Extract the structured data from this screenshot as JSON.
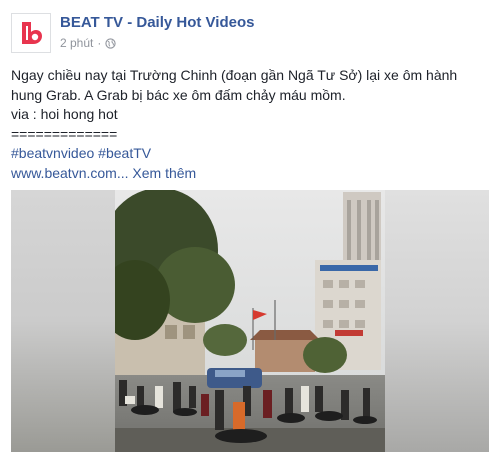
{
  "post": {
    "page_name": "BEAT TV - Daily Hot Videos",
    "timestamp": "2 phút",
    "separator": "·",
    "privacy_icon": "globe-icon",
    "avatar_icon": "beat-logo-icon",
    "text_lines": [
      "Ngay chiều nay tại Trường Chinh (đoạn gần Ngã Tư Sở) lại xe ôm hành",
      "hung Grab. A Grab bị bác xe ôm đấm chảy máu mồm.",
      "via : hoi hong hot",
      "============="
    ],
    "hashtags": "#beatvnvideo #beatTV",
    "url_text": "www.beatvn.com...",
    "see_more": "Xem thêm"
  },
  "colors": {
    "link": "#365899",
    "text": "#1d2129",
    "meta": "#90949c",
    "brand": "#e8344e"
  }
}
